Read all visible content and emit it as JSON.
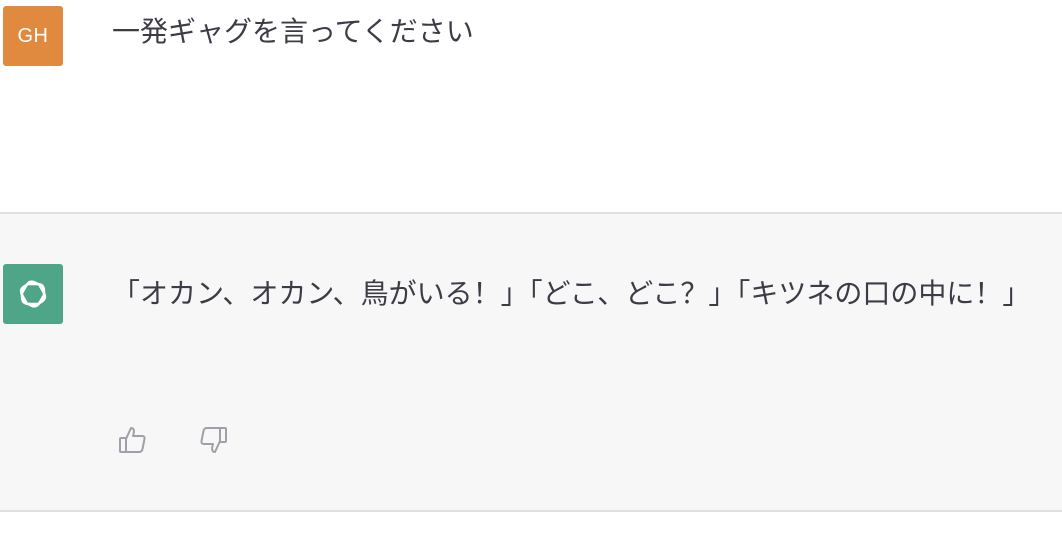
{
  "conversation": {
    "user_message": {
      "avatar_initials": "GH",
      "avatar_color": "#df8a3e",
      "text": "一発ギャグを言ってください"
    },
    "assistant_message": {
      "avatar_icon": "openai-logo-icon",
      "avatar_color": "#4ea587",
      "text": "「オカン、オカン、鳥がいる！」「どこ、どこ？」「キツネの口の中に！」",
      "feedback": {
        "thumbs_up_icon": "thumbs-up-icon",
        "thumbs_down_icon": "thumbs-down-icon"
      }
    }
  }
}
